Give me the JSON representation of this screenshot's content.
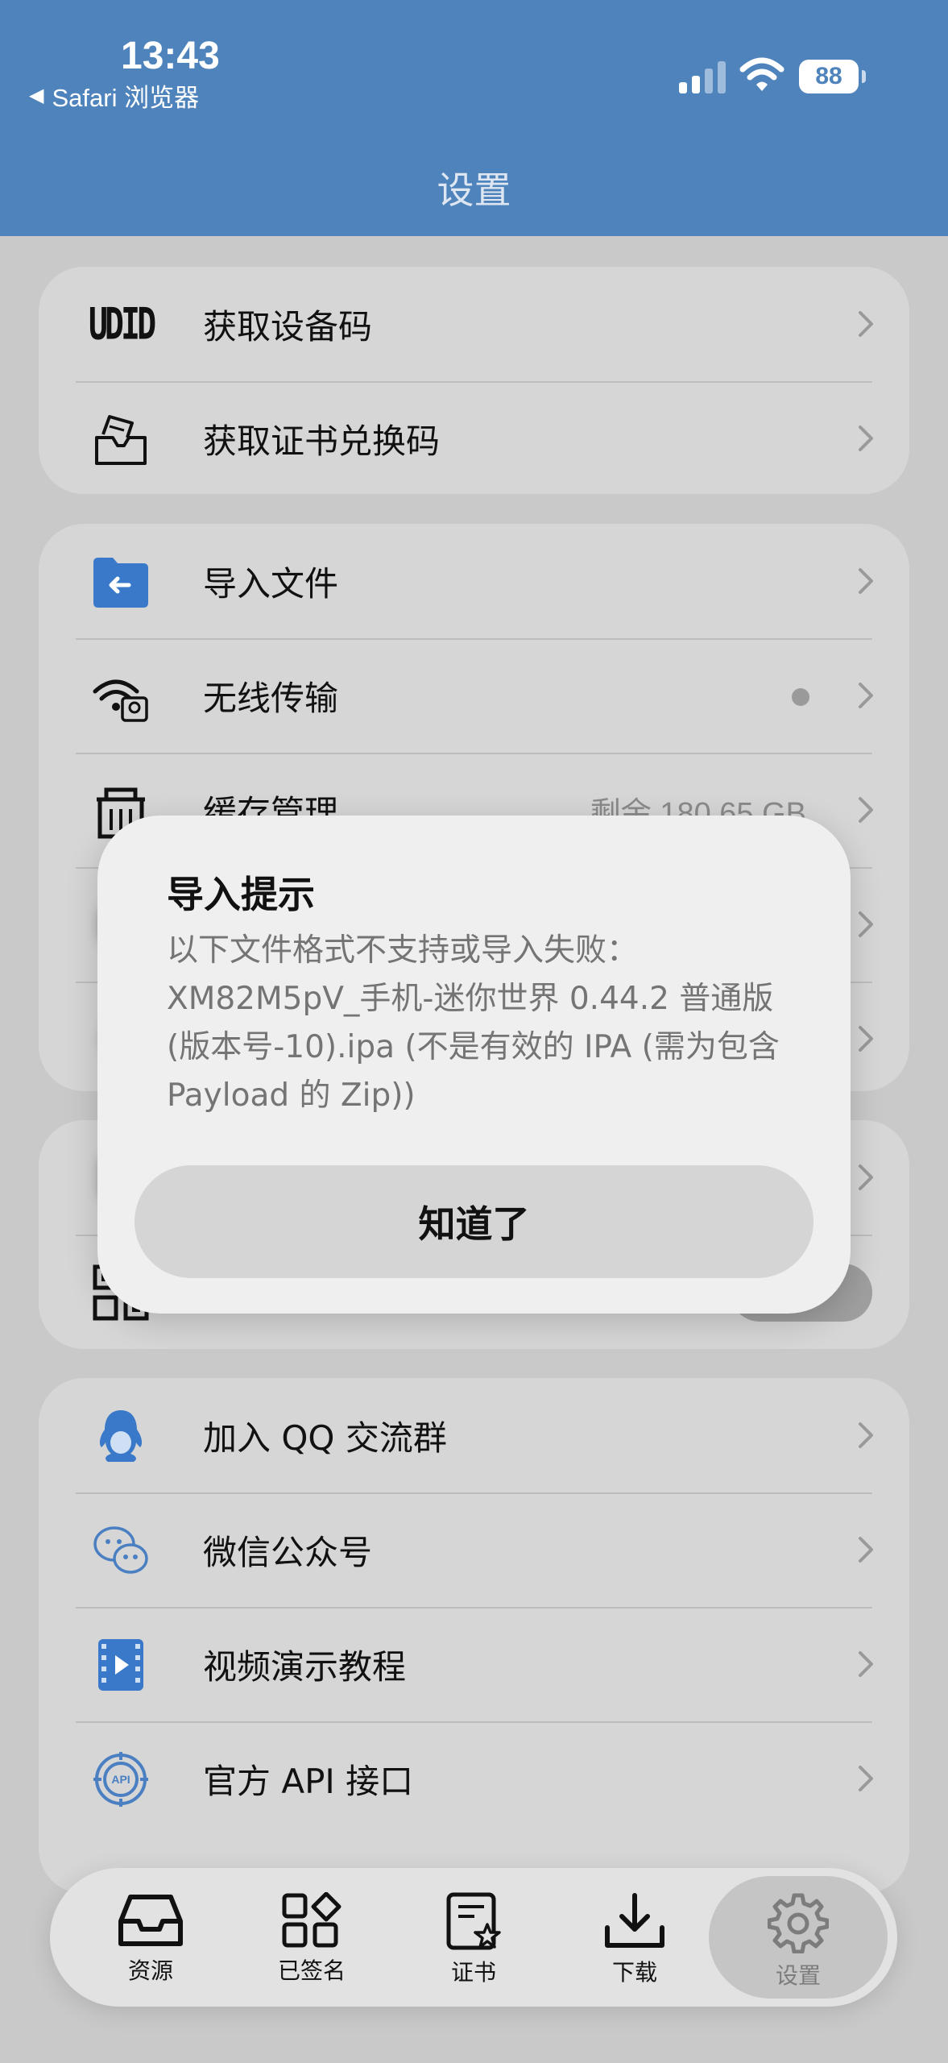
{
  "status": {
    "time": "13:43",
    "back_app": "Safari 浏览器",
    "battery": "88"
  },
  "nav": {
    "title": "设置"
  },
  "groups": {
    "account": {
      "items": [
        {
          "label": "获取设备码",
          "icon": "udid-icon",
          "icon_text": "UDID"
        },
        {
          "label": "获取证书兑换码",
          "icon": "certificate-code-icon"
        }
      ]
    },
    "files": {
      "items": [
        {
          "label": "导入文件",
          "icon": "folder-import-icon"
        },
        {
          "label": "无线传输",
          "icon": "wireless-transfer-icon"
        },
        {
          "label": "缓存管理",
          "icon": "cache-icon",
          "detail": "剩余 180.65 GB"
        }
      ]
    },
    "community": {
      "items": [
        {
          "label": "加入 QQ 交流群",
          "icon": "qq-icon"
        },
        {
          "label": "微信公众号",
          "icon": "wechat-icon"
        },
        {
          "label": "视频演示教程",
          "icon": "video-icon"
        },
        {
          "label": "官方 API 接口",
          "icon": "api-icon"
        }
      ]
    }
  },
  "dialog": {
    "title": "导入提示",
    "message": "以下文件格式不支持或导入失败：XM82M5pV_手机-迷你世界 0.44.2 普通版 (版本号-10).ipa (不是有效的 IPA (需为包含 Payload 的 Zip))",
    "confirm": "知道了"
  },
  "tabbar": {
    "active": "设置",
    "tabs": [
      {
        "label": "资源",
        "icon": "inbox-icon"
      },
      {
        "label": "已签名",
        "icon": "grid-apps-icon"
      },
      {
        "label": "证书",
        "icon": "certificate-icon"
      },
      {
        "label": "下载",
        "icon": "download-icon"
      },
      {
        "label": "设置",
        "icon": "gear-icon"
      }
    ]
  }
}
